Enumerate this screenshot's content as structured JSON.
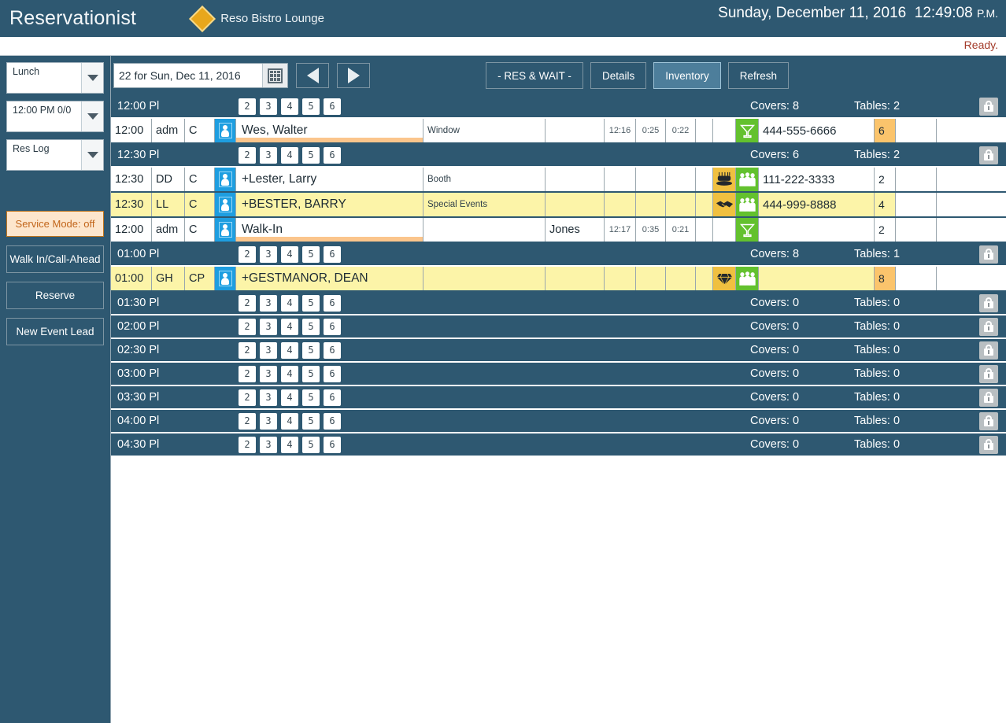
{
  "header": {
    "app_title": "Reservationist",
    "venue_name": "Reso Bistro Lounge",
    "venue_icon": "diamond-icon",
    "date_text": "Sunday, December 11, 2016",
    "time_text": "12:49:08",
    "ampm": "P.M.",
    "status": "Ready.",
    "accent_color": "#e8a71c",
    "bar_color": "#2e5871",
    "status_color": "#a33b2a"
  },
  "sidebar": {
    "combos": [
      {
        "name": "meal-period-select",
        "value": "Lunch"
      },
      {
        "name": "time-slot-select",
        "value": "12:00 PM   0/0"
      },
      {
        "name": "view-mode-select",
        "value": "Res Log"
      }
    ],
    "service_mode": "Service Mode: off",
    "buttons": [
      {
        "name": "walk-in-call-ahead-button",
        "label": "Walk In/Call-Ahead"
      },
      {
        "name": "reserve-button",
        "label": "Reserve"
      },
      {
        "name": "new-event-lead-button",
        "label": "New Event Lead"
      }
    ]
  },
  "toolbar": {
    "date_value": "22 for Sun, Dec 11, 2016",
    "calendar_icon": "calendar-icon",
    "prev_icon": "previous-day-icon",
    "next_icon": "next-day-icon",
    "buttons": [
      {
        "name": "res-and-wait-button",
        "label": "- RES & WAIT -",
        "active": false
      },
      {
        "name": "details-button",
        "label": "Details",
        "active": false
      },
      {
        "name": "inventory-button",
        "label": "Inventory",
        "active": true
      },
      {
        "name": "refresh-button",
        "label": "Refresh",
        "active": false
      }
    ]
  },
  "grid": {
    "party_buttons": [
      "2",
      "3",
      "4",
      "5",
      "6"
    ],
    "covers_label": "Covers:",
    "tables_label": "Tables:",
    "lock_icon": "lock-icon",
    "slots": [
      {
        "time": "12:00 Pl",
        "covers": "8",
        "tables": "2",
        "rows": [
          {
            "time": "12:00",
            "initials": "adm",
            "code": "C",
            "person_icon": "person-icon",
            "name": "Wes, Walter",
            "name_underline": true,
            "highlight": false,
            "note": "Window",
            "server": "",
            "t1": "12:16",
            "t2": "0:25",
            "t3": "0:22",
            "icon1": "",
            "icon1_bg": "",
            "icon2": "martini-icon",
            "icon2_bg": "#63c12e",
            "phone": "444-555-6666",
            "party": "6",
            "party_amber": true
          }
        ]
      },
      {
        "time": "12:30 Pl",
        "covers": "6",
        "tables": "2",
        "rows": [
          {
            "time": "12:30",
            "initials": "DD",
            "code": "C",
            "person_icon": "person-icon",
            "name": "+Lester, Larry",
            "name_underline": false,
            "highlight": false,
            "note": "Booth",
            "server": "",
            "t1": "",
            "t2": "",
            "t3": "",
            "icon1": "birthday-cake-icon",
            "icon1_bg": "#f0c040",
            "icon2": "group-icon",
            "icon2_bg": "#63c12e",
            "phone": "111-222-3333",
            "party": "2",
            "party_amber": false
          },
          {
            "time": "12:30",
            "initials": "LL",
            "code": "C",
            "person_icon": "person-icon",
            "name": "+BESTER, BARRY",
            "name_underline": false,
            "highlight": true,
            "note": "Special Events",
            "server": "",
            "t1": "",
            "t2": "",
            "t3": "",
            "icon1": "handshake-icon",
            "icon1_bg": "#f0c040",
            "icon2": "group-icon",
            "icon2_bg": "#63c12e",
            "phone": "444-999-8888",
            "party": "4",
            "party_amber": false
          },
          {
            "time": "12:00",
            "initials": "adm",
            "code": "C",
            "person_icon": "person-icon",
            "name": "Walk-In",
            "name_underline": true,
            "highlight": false,
            "note": "",
            "server": "Jones",
            "t1": "12:17",
            "t2": "0:35",
            "t3": "0:21",
            "icon1": "",
            "icon1_bg": "",
            "icon2": "martini-icon",
            "icon2_bg": "#63c12e",
            "phone": "",
            "party": "2",
            "party_amber": false
          }
        ]
      },
      {
        "time": "01:00 Pl",
        "covers": "8",
        "tables": "1",
        "rows": [
          {
            "time": "01:00",
            "initials": "GH",
            "code": "CP",
            "person_icon": "person-icon",
            "name": "+GESTMANOR, DEAN",
            "name_underline": false,
            "highlight": true,
            "note": "",
            "server": "",
            "t1": "",
            "t2": "",
            "t3": "",
            "icon1": "diamond-gem-icon",
            "icon1_bg": "#f0c040",
            "icon2": "group-icon",
            "icon2_bg": "#63c12e",
            "phone": "",
            "party": "8",
            "party_amber": true
          }
        ]
      },
      {
        "time": "01:30 Pl",
        "covers": "0",
        "tables": "0",
        "rows": []
      },
      {
        "time": "02:00 Pl",
        "covers": "0",
        "tables": "0",
        "rows": []
      },
      {
        "time": "02:30 Pl",
        "covers": "0",
        "tables": "0",
        "rows": []
      },
      {
        "time": "03:00 Pl",
        "covers": "0",
        "tables": "0",
        "rows": []
      },
      {
        "time": "03:30 Pl",
        "covers": "0",
        "tables": "0",
        "rows": []
      },
      {
        "time": "04:00 Pl",
        "covers": "0",
        "tables": "0",
        "rows": []
      },
      {
        "time": "04:30 Pl",
        "covers": "0",
        "tables": "0",
        "rows": []
      }
    ]
  }
}
